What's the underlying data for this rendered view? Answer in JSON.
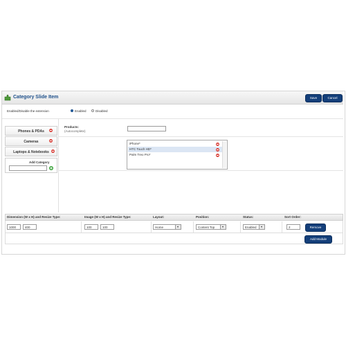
{
  "header": {
    "title": "Category Slide Item",
    "save_label": "Save",
    "cancel_label": "Cancel",
    "icon": "puzzle-icon"
  },
  "status": {
    "label": "Enabled/Disable the extension",
    "enabled_label": "Enabled",
    "disabled_label": "Disabled",
    "selected": "Enabled"
  },
  "categories": {
    "tabs": [
      {
        "label": "Phones & PDAs"
      },
      {
        "label": "Cameras"
      },
      {
        "label": "Laptops & Notebooks"
      }
    ],
    "add_label": "Add Category",
    "add_input_value": ""
  },
  "products": {
    "label": "Products:",
    "hint": "(Autocomplete)",
    "input_value": "",
    "items": [
      {
        "label": "iPhone*",
        "selected": false
      },
      {
        "label": "HTC Touch HD*",
        "selected": true
      },
      {
        "label": "Palm Treo Pro*",
        "selected": false
      }
    ]
  },
  "modules": {
    "columns": {
      "dimension": "Dimension (W x H) and Resize Type:",
      "image": "Image (W x H) and Resize Type:",
      "layout": "Layout:",
      "position": "Position:",
      "status": "Status:",
      "sort": "Sort Order:"
    },
    "row": {
      "dim_w": "1000",
      "dim_h": "400",
      "img_w": "100",
      "img_h": "100",
      "layout": "Home",
      "position": "Content Top",
      "status": "Enabled",
      "sort": "2",
      "remove_label": "Remove"
    },
    "add_module_label": "Add Module"
  },
  "colors": {
    "accent": "#143f7a",
    "remove_red": "#d9413a",
    "add_green": "#3aa33a"
  }
}
